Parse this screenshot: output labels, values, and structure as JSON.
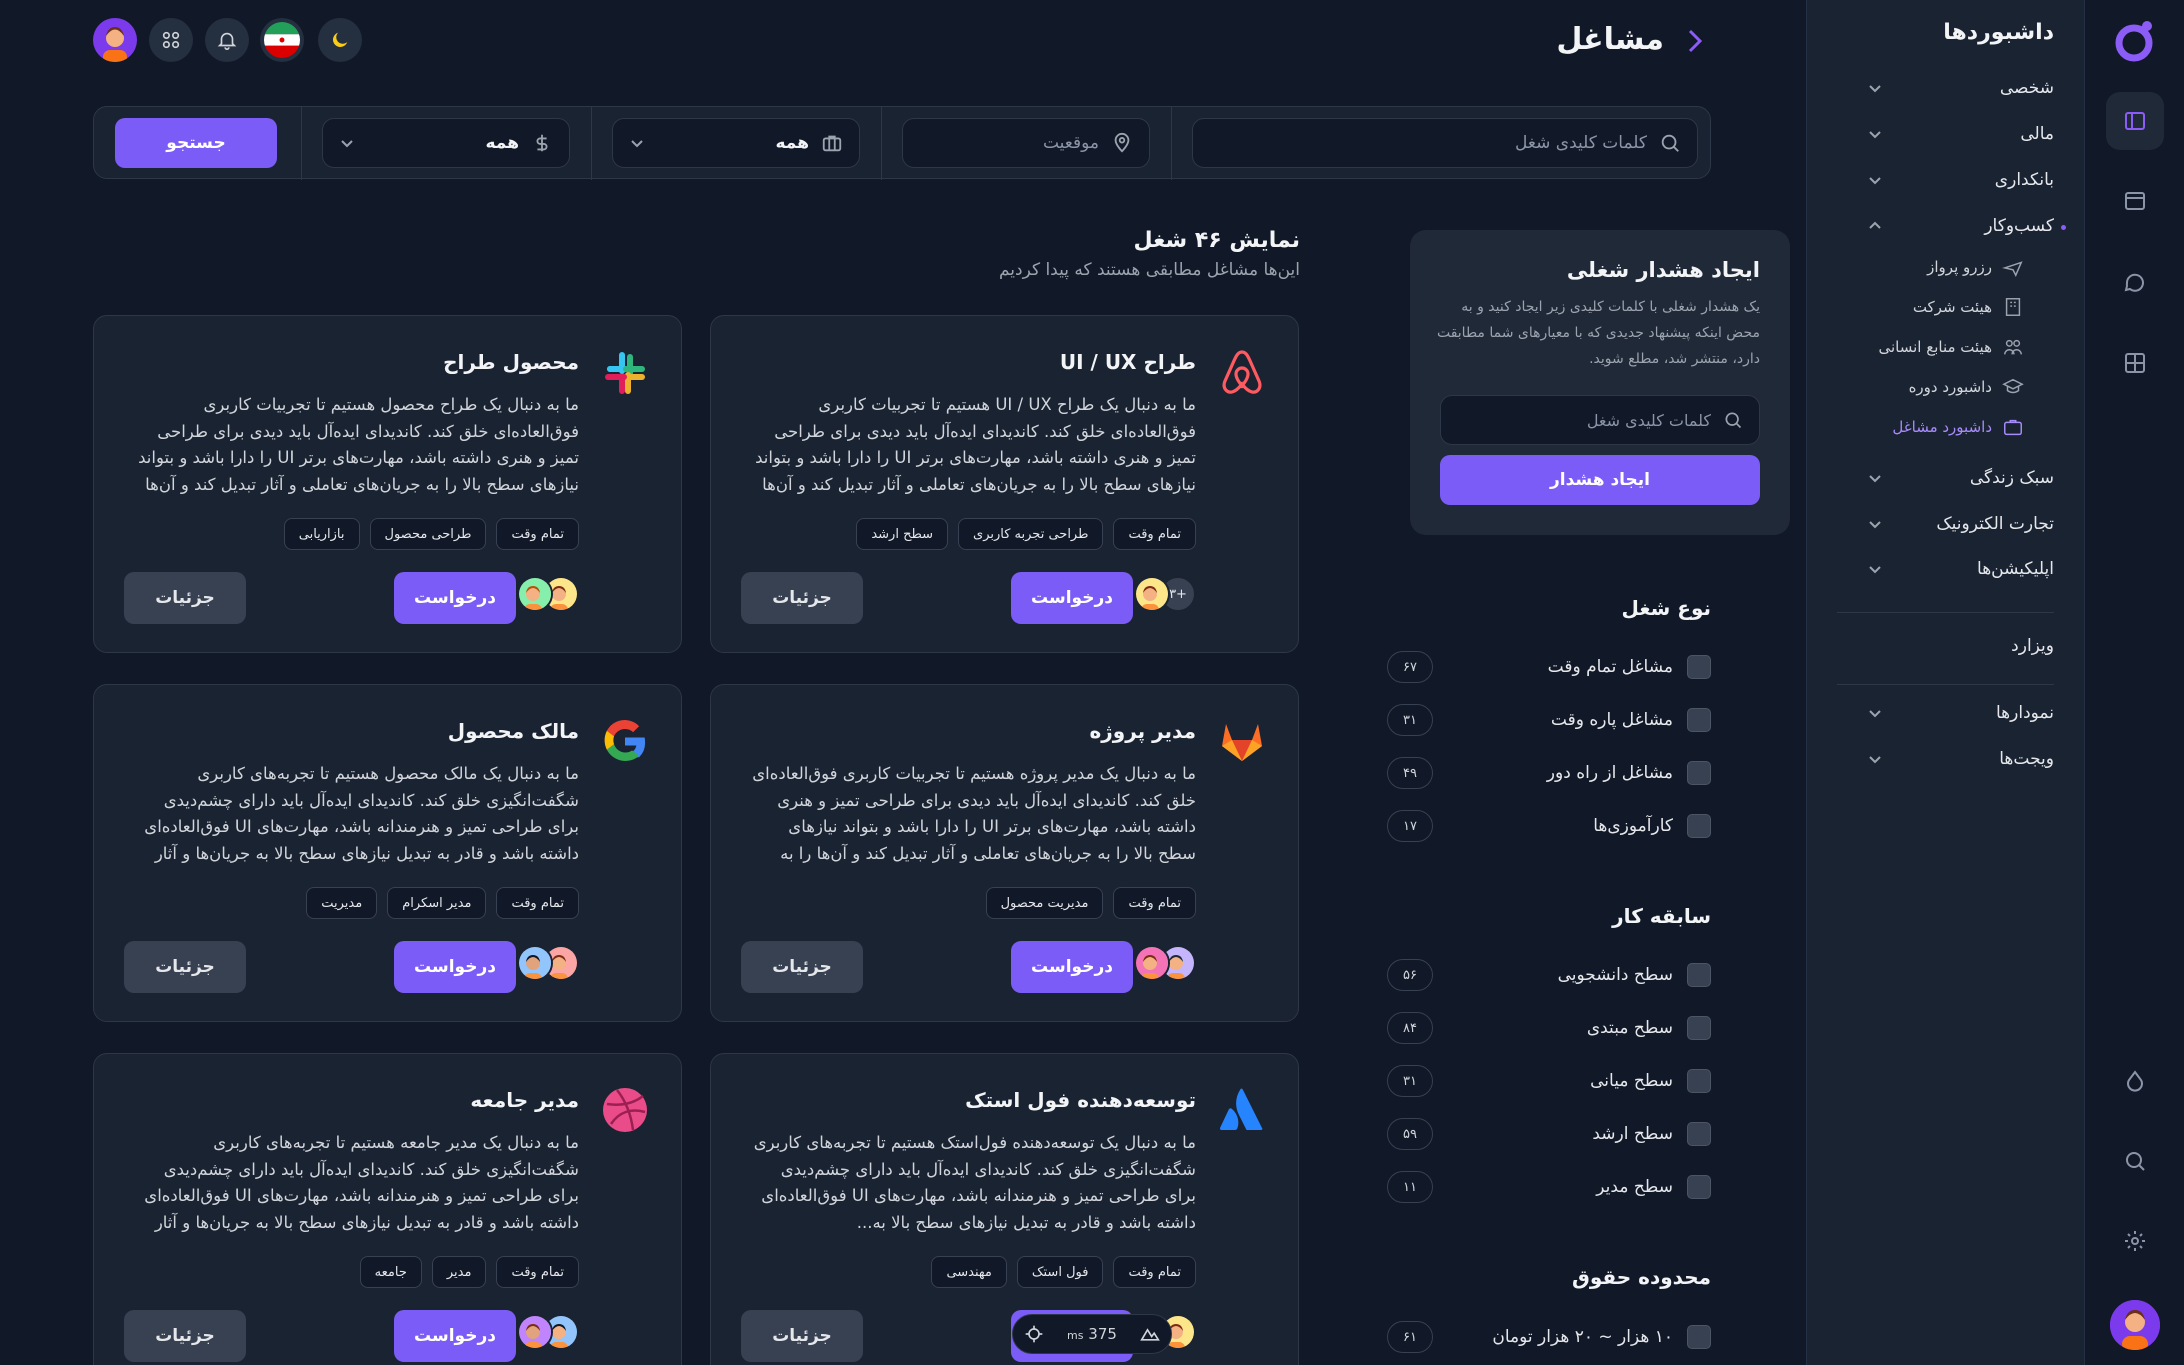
{
  "rail": {
    "icons": [
      "layout-icon",
      "window-icon",
      "chat-icon",
      "grid-icon",
      "drop-icon",
      "search-icon",
      "settings-icon"
    ]
  },
  "sidebar": {
    "title": "داشبوردها",
    "groups": [
      {
        "label": "شخصی"
      },
      {
        "label": "مالی"
      },
      {
        "label": "بانکداری"
      },
      {
        "label": "کسب‌وکار"
      }
    ],
    "business_items": [
      {
        "label": "رزرو پرواز",
        "icon": "plane-icon"
      },
      {
        "label": "هیئت شرکت",
        "icon": "building-icon"
      },
      {
        "label": "هیئت منابع انسانی",
        "icon": "users-icon"
      },
      {
        "label": "داشبورد دوره",
        "icon": "graduation-icon"
      },
      {
        "label": "داشبورد مشاغل",
        "icon": "briefcase-icon"
      }
    ],
    "more_groups": [
      {
        "label": "سبک زندگی"
      },
      {
        "label": "تجارت الکترونیک"
      },
      {
        "label": "اپلیکیشن‌ها"
      }
    ],
    "wizard": "ویزارد",
    "bottom_groups": [
      {
        "label": "نمودارها"
      },
      {
        "label": "ویجت‌ها"
      }
    ]
  },
  "header": {
    "title": "مشاغل"
  },
  "search": {
    "keywords_placeholder": "کلمات کلیدی شغل",
    "location_placeholder": "موقعیت",
    "type_value": "همه",
    "salary_value": "همه",
    "button": "جستجو"
  },
  "alert": {
    "title": "ایجاد هشدار شغلی",
    "text": "یک هشدار شغلی با کلمات کلیدی زیر ایجاد کنید و به محض اینکه پیشنهاد جدیدی که با معیارهای شما مطابقت دارد، منتشر شد، مطلع شوید.",
    "placeholder": "کلمات کلیدی شغل",
    "button": "ایجاد هشدار"
  },
  "filters": {
    "job_type": {
      "title": "نوع شغل",
      "items": [
        {
          "label": "مشاغل تمام وقت",
          "count": "۶۷"
        },
        {
          "label": "مشاغل پاره وقت",
          "count": "۳۱"
        },
        {
          "label": "مشاغل از راه دور",
          "count": "۴۹"
        },
        {
          "label": "کارآموزی‌ها",
          "count": "۱۷"
        }
      ]
    },
    "experience": {
      "title": "سابقه کار",
      "items": [
        {
          "label": "سطح دانشجویی",
          "count": "۵۶"
        },
        {
          "label": "سطح مبتدی",
          "count": "۸۴"
        },
        {
          "label": "سطح میانی",
          "count": "۳۱"
        },
        {
          "label": "سطح ارشد",
          "count": "۵۹"
        },
        {
          "label": "سطح مدیر",
          "count": "۱۱"
        }
      ]
    },
    "salary": {
      "title": "محدوده حقوق",
      "items": [
        {
          "label": "۱۰ هزار ~ ۲۰ هزار تومان",
          "count": "۶۱"
        }
      ]
    }
  },
  "jobs_header": {
    "title": "نمایش ۴۶ شغل",
    "subtitle": "این‌ها مشاغل مطابقی هستند که پیدا کردیم"
  },
  "jobs": [
    {
      "title": "طراح UI / UX",
      "logo": "airbnb-icon",
      "desc": "ما به دنبال یک طراح UI / UX هستیم تا تجربیات کاربری فوق‌العاده‌ای خلق کند. کاندیدای ایده‌آل باید دیدی برای طراحی تمیز و هنری داشته باشد، مهارت‌های برتر UI را دارا باشد و بتواند نیازهای سطح بالا را به جریان‌های تعاملی و آثار تبدیل کند و آن‌ها ...",
      "tags": [
        "تمام وقت",
        "طراحی تجربه کاربری",
        "سطح ارشد"
      ],
      "more": "+۳",
      "apply": "درخواست",
      "details": "جزئیات"
    },
    {
      "title": "محصول طراح",
      "logo": "slack-icon",
      "desc": "ما به دنبال یک طراح محصول هستیم تا تجربیات کاربری فوق‌العاده‌ای خلق کند. کاندیدای ایده‌آل باید دیدی برای طراحی تمیز و هنری داشته باشد، مهارت‌های برتر UI را دارا باشد و بتواند نیازهای سطح بالا را به جریان‌های تعاملی و آثار تبدیل کند و آن‌ها ...",
      "tags": [
        "تمام وقت",
        "طراحی محصول",
        "بازاریابی"
      ],
      "more": "",
      "apply": "درخواست",
      "details": "جزئیات"
    },
    {
      "title": "مدیر پروژه",
      "logo": "gitlab-icon",
      "desc": "ما به دنبال یک مدیر پروژه هستیم تا تجربیات کاربری فوق‌العاده‌ای خلق کند. کاندیدای ایده‌آل باید دیدی برای طراحی تمیز و هنری داشته باشد، مهارت‌های برتر UI را دارا باشد و بتواند نیازهای سطح بالا را به جریان‌های تعاملی و آثار تبدیل کند و آن‌ها را به رابطه‌ای...",
      "tags": [
        "تمام وقت",
        "مدیریت محصول"
      ],
      "more": "",
      "apply": "درخواست",
      "details": "جزئیات"
    },
    {
      "title": "مالک محصول",
      "logo": "google-icon",
      "desc": "ما به دنبال یک مالک محصول هستیم تا تجربه‌های کاربری شگفت‌انگیزی خلق کند. کاندیدای ایده‌آل باید دارای چشم‌دیدی برای طراحی تمیز و هنرمندانه باشد، مهارت‌های UI فوق‌العاده‌ای داشته باشد و قادر به تبدیل نیازهای سطح بالا به جریان‌ها و آثار تعامل و...",
      "tags": [
        "تمام وقت",
        "مدیر اسکرام",
        "مدیریت"
      ],
      "more": "",
      "apply": "درخواست",
      "details": "جزئیات"
    },
    {
      "title": "توسعه‌دهنده فول استک",
      "logo": "atlassian-icon",
      "desc": "ما به دنبال یک توسعه‌دهنده فول‌استک هستیم تا تجربه‌های کاربری شگفت‌انگیزی خلق کند. کاندیدای ایده‌آل باید دارای چشم‌دیدی برای طراحی تمیز و هنرمندانه باشد، مهارت‌های UI فوق‌العاده‌ای داشته باشد و قادر به تبدیل نیازهای سطح بالا به...",
      "tags": [
        "تمام وقت",
        "فول استک",
        "مهندسی"
      ],
      "more": "",
      "apply": "درخواست",
      "details": "جزئیات"
    },
    {
      "title": "مدیر جامعه",
      "logo": "dribbble-icon",
      "desc": "ما به دنبال یک مدیر جامعه هستیم تا تجربه‌های کاربری شگفت‌انگیزی خلق کند. کاندیدای ایده‌آل باید دارای چشم‌دیدی برای طراحی تمیز و هنرمندانه باشد، مهارت‌های UI فوق‌العاده‌ای داشته باشد و قادر به تبدیل نیازهای سطح بالا به جریان‌ها و آثار تعامل و...",
      "tags": [
        "تمام وقت",
        "مدیر",
        "جامعه"
      ],
      "more": "",
      "apply": "درخواست",
      "details": "جزئیات"
    }
  ],
  "perf": {
    "value": "375",
    "unit": "ms"
  },
  "colors": {
    "accent": "#7c5cf6",
    "bg": "#111827",
    "card": "#1a2332"
  }
}
